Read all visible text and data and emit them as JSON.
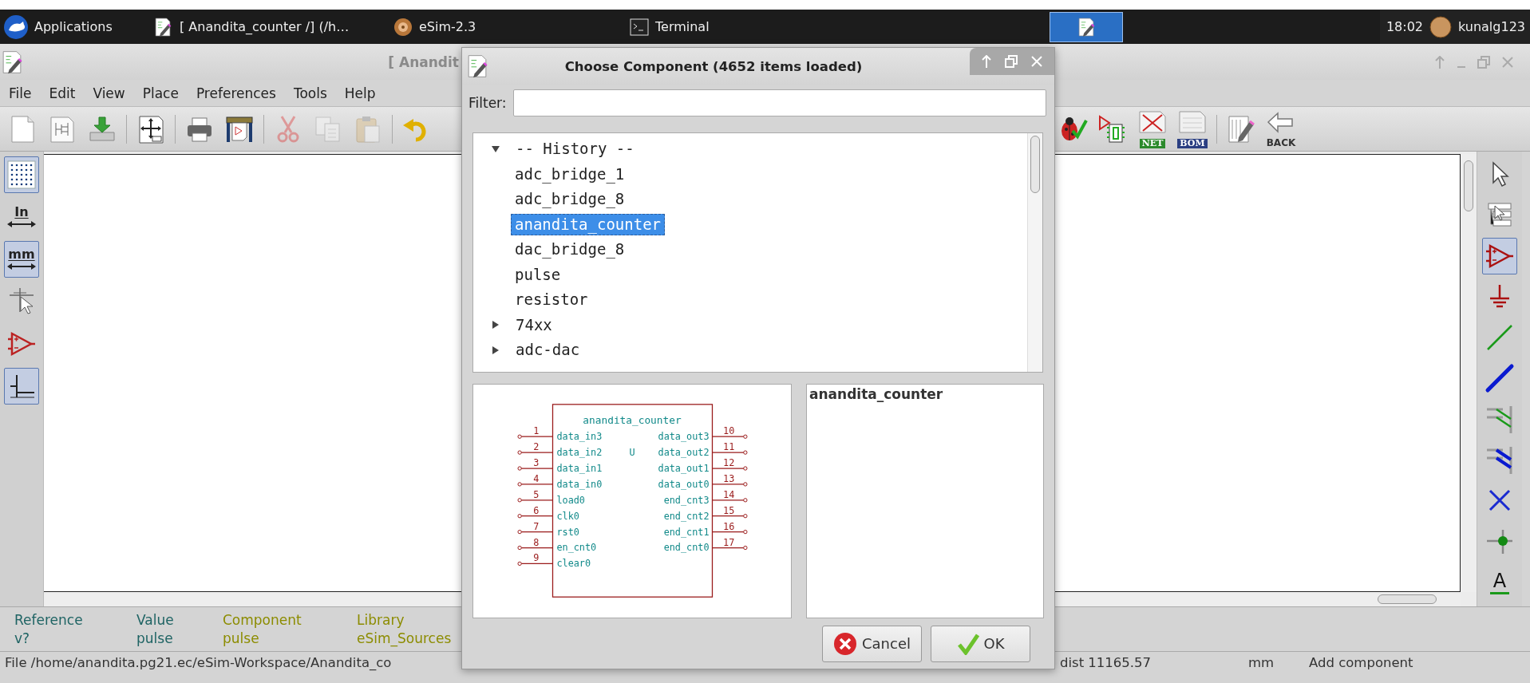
{
  "taskbar": {
    "app_menu": "Applications",
    "windows": [
      {
        "kind": "schematic",
        "label": "[ Anandita_counter /] (/h…"
      },
      {
        "kind": "esim",
        "label": "eSim-2.3"
      },
      {
        "kind": "terminal",
        "label": "Terminal"
      }
    ],
    "clock": "18:02",
    "user": "kunalg123"
  },
  "main_window": {
    "title": "[ Anandit",
    "menu": [
      "File",
      "Edit",
      "View",
      "Place",
      "Preferences",
      "Tools",
      "Help"
    ],
    "toolbar": [
      [
        {
          "kind": "new",
          "disabled": false
        },
        {
          "kind": "sheet",
          "disabled": false
        },
        {
          "kind": "save",
          "disabled": false
        }
      ],
      [
        {
          "kind": "pagesize",
          "disabled": false
        }
      ],
      [
        {
          "kind": "print",
          "disabled": false
        },
        {
          "kind": "plot",
          "disabled": false
        }
      ],
      [
        {
          "kind": "cut",
          "disabled": true
        },
        {
          "kind": "copy",
          "disabled": true
        },
        {
          "kind": "paste",
          "disabled": true
        }
      ],
      [
        {
          "kind": "undo",
          "disabled": false
        }
      ]
    ],
    "toolbar_right": [
      [
        {
          "kind": "erc"
        },
        {
          "kind": "netcomp"
        },
        {
          "kind": "net",
          "label": "NET"
        },
        {
          "kind": "bom",
          "label": "BOM"
        }
      ],
      [
        {
          "kind": "editfields"
        },
        {
          "kind": "back",
          "label": "BACK"
        }
      ]
    ],
    "left_toolbar": [
      {
        "kind": "grid",
        "selected": true
      },
      {
        "kind": "units",
        "label": "In",
        "selected": false
      },
      {
        "kind": "units",
        "label": "mm",
        "selected": true
      },
      {
        "kind": "cursor",
        "selected": false
      },
      {
        "kind": "component",
        "selected": false
      },
      {
        "kind": "pin",
        "selected": true
      }
    ],
    "right_toolbar": [
      {
        "kind": "select",
        "selected": false
      },
      {
        "kind": "hierarchy",
        "selected": false
      },
      {
        "kind": "component",
        "selected": true
      },
      {
        "kind": "power",
        "selected": false
      },
      {
        "kind": "wire",
        "selected": false
      },
      {
        "kind": "bus",
        "selected": false
      },
      {
        "kind": "wire_entry",
        "selected": false
      },
      {
        "kind": "bus_entry",
        "selected": false
      },
      {
        "kind": "noconnect",
        "selected": false
      },
      {
        "kind": "junction",
        "selected": false
      },
      {
        "kind": "text",
        "label": "A",
        "selected": false
      }
    ],
    "message_panel": [
      {
        "label": "Reference",
        "value": "v?",
        "color": "#1f6464"
      },
      {
        "label": "Value",
        "value": "pulse",
        "color": "#1f6464"
      },
      {
        "label": "Component",
        "value": "pulse",
        "color": "#8c8c00"
      },
      {
        "label": "Library",
        "value": "eSim_Sources",
        "color": "#8c8c00"
      }
    ],
    "status_bar": {
      "file": "File /home/anandita.pg21.ec/eSim-Workspace/Anandita_co",
      "distance": "dist 11165.57",
      "units": "mm",
      "mode": "Add component"
    }
  },
  "dialog": {
    "title": "Choose Component (4652 items loaded)",
    "filter_label": "Filter:",
    "tree": [
      {
        "label": "-- History --",
        "expanded": true,
        "children": [
          {
            "label": "adc_bridge_1",
            "selected": false
          },
          {
            "label": "adc_bridge_8",
            "selected": false
          },
          {
            "label": "anandita_counter",
            "selected": true
          },
          {
            "label": "dac_bridge_8",
            "selected": false
          },
          {
            "label": "pulse",
            "selected": false
          },
          {
            "label": "resistor",
            "selected": false
          }
        ]
      },
      {
        "label": "74xx",
        "expanded": false
      },
      {
        "label": "adc-dac",
        "expanded": false
      }
    ],
    "preview": {
      "symbol": "anandita_counter",
      "reference": "U",
      "left_pins": [
        {
          "number": "1",
          "name": "data_in3"
        },
        {
          "number": "2",
          "name": "data_in2"
        },
        {
          "number": "3",
          "name": "data_in1"
        },
        {
          "number": "4",
          "name": "data_in0"
        },
        {
          "number": "5",
          "name": "load0"
        },
        {
          "number": "6",
          "name": "clk0"
        },
        {
          "number": "7",
          "name": "rst0"
        },
        {
          "number": "8",
          "name": "en_cnt0"
        },
        {
          "number": "9",
          "name": "clear0"
        }
      ],
      "right_pins": [
        {
          "number": "10",
          "name": "data_out3"
        },
        {
          "number": "11",
          "name": "data_out2"
        },
        {
          "number": "12",
          "name": "data_out1"
        },
        {
          "number": "13",
          "name": "data_out0"
        },
        {
          "number": "14",
          "name": "end_cnt3"
        },
        {
          "number": "15",
          "name": "end_cnt2"
        },
        {
          "number": "16",
          "name": "end_cnt1"
        },
        {
          "number": "17",
          "name": "end_cnt0"
        }
      ]
    },
    "info_title": "anandita_counter",
    "buttons": [
      {
        "kind": "cancel",
        "label": "Cancel"
      },
      {
        "kind": "ok",
        "label": "OK"
      }
    ]
  }
}
